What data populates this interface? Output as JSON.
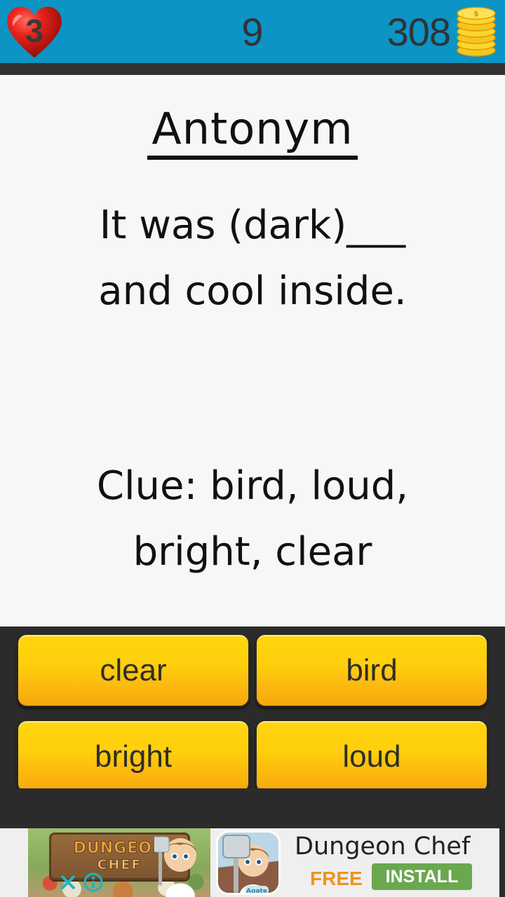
{
  "statusbar": {
    "lives": "3",
    "lives_icon": "heart-icon",
    "score": "9",
    "coins": "308",
    "coins_icon": "coin-stack-icon",
    "bg_color": "#0c94c4",
    "text_color": "#2f3437"
  },
  "question": {
    "category": "Antonym",
    "prompt_line1": "It was (dark)___",
    "prompt_line2": "and cool inside.",
    "clue_line1": "Clue: bird, loud,",
    "clue_line2": "bright, clear",
    "bg_color": "#f7f7f7"
  },
  "answers": {
    "rows": [
      [
        {
          "label": "clear"
        },
        {
          "label": "bird"
        }
      ],
      [
        {
          "label": "bright"
        },
        {
          "label": "loud"
        }
      ]
    ],
    "panel_color": "#2b2b2b",
    "button_top_color": "#ffd60f",
    "button_bottom_color": "#f5a80c",
    "button_text_color": "#2e2e28"
  },
  "ad": {
    "sign_line1": "DUNGEON",
    "sign_line2": "CHEF",
    "app_badge": "Agate",
    "title": "Dungeon Chef",
    "price": "FREE",
    "install_label": "INSTALL",
    "close_icon": "close-x-icon",
    "info_icon": "info-icon",
    "install_color": "#6aa84f",
    "price_color": "#f0921e",
    "bg_color": "#efefef"
  }
}
